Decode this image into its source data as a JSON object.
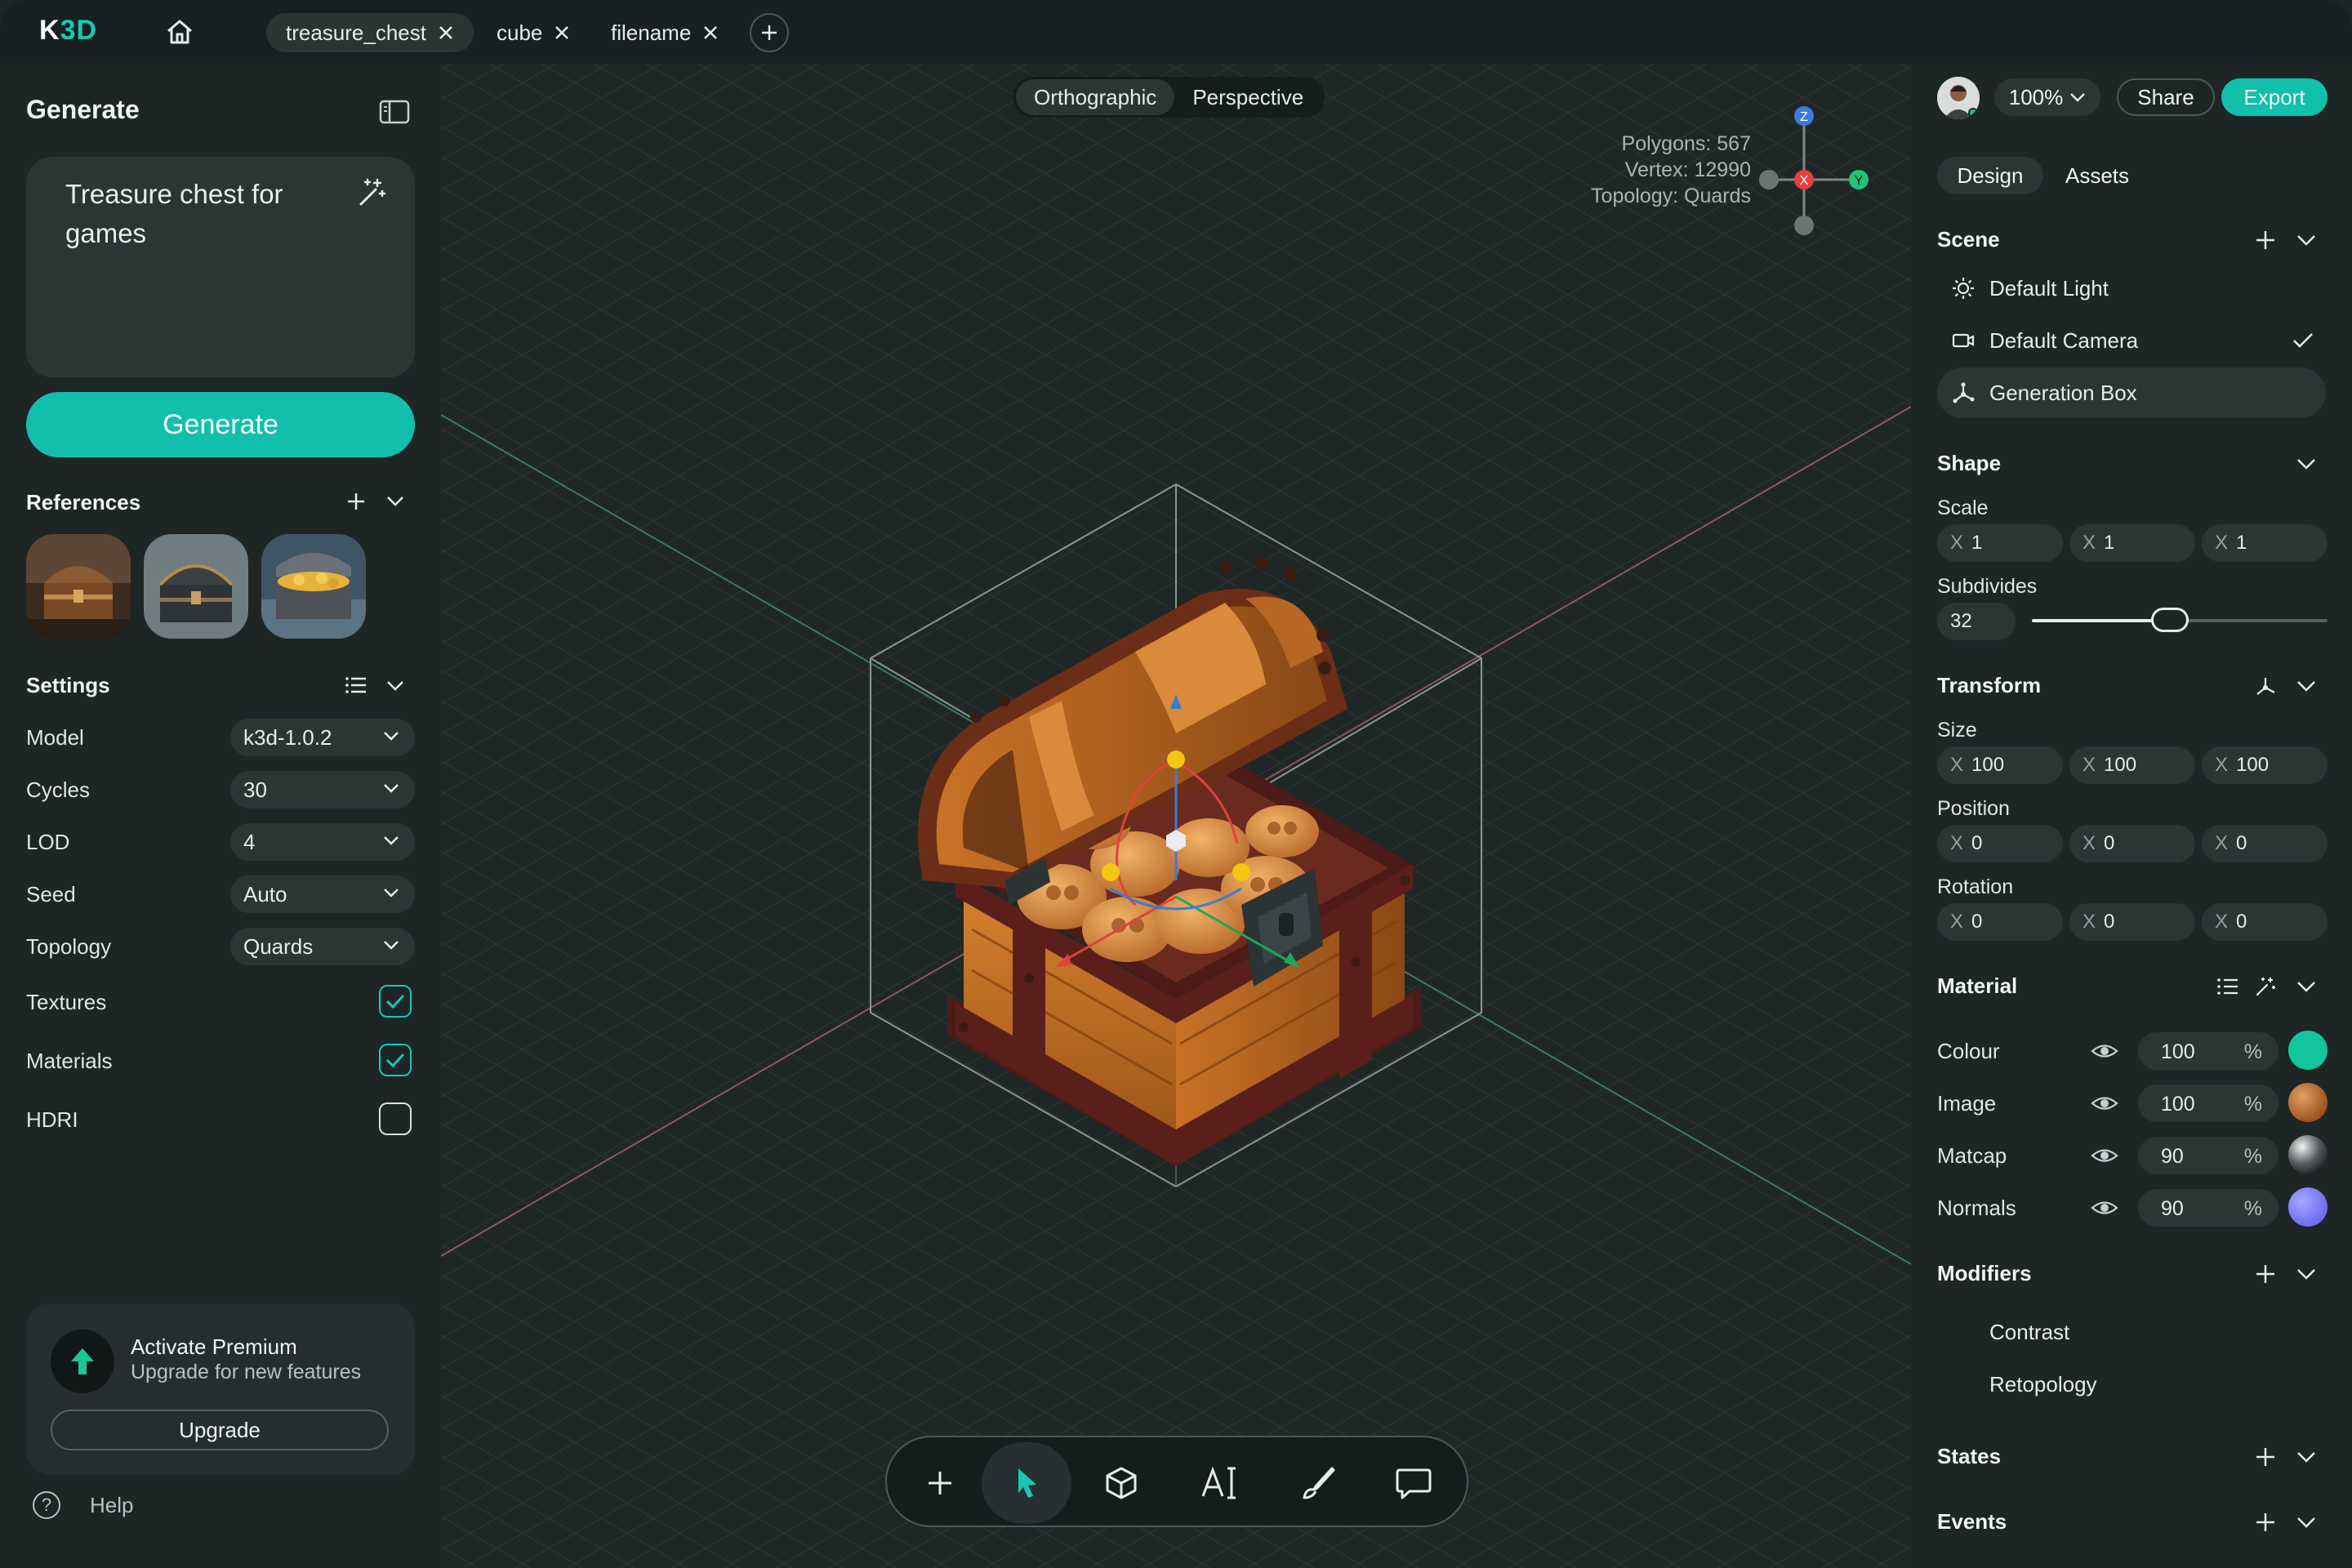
{
  "app": {
    "logo_prefix": "K",
    "logo_accent": "3D",
    "brand_color": "#12bfad"
  },
  "tabs": [
    {
      "label": "treasure_chest",
      "active": true
    },
    {
      "label": "cube",
      "active": false
    },
    {
      "label": "filename",
      "active": false
    }
  ],
  "left": {
    "title": "Generate",
    "prompt": "Treasure chest for games",
    "generate_label": "Generate",
    "references_label": "References",
    "settings_label": "Settings",
    "settings": [
      {
        "label": "Model",
        "value": "k3d-1.0.2"
      },
      {
        "label": "Cycles",
        "value": "30"
      },
      {
        "label": "LOD",
        "value": "4"
      },
      {
        "label": "Seed",
        "value": "Auto"
      },
      {
        "label": "Topology",
        "value": "Quards"
      }
    ],
    "toggles": [
      {
        "label": "Textures",
        "checked": true
      },
      {
        "label": "Materials",
        "checked": true
      },
      {
        "label": "HDRI",
        "checked": false
      }
    ],
    "premium": {
      "title": "Activate Premium",
      "subtitle": "Upgrade for new features",
      "button": "Upgrade"
    },
    "help": "Help"
  },
  "viewport": {
    "views": [
      "Orthographic",
      "Perspective"
    ],
    "active_view": "Perspective",
    "stats": [
      "Polygons: 567",
      "Vertex: 12990",
      "Topology: Quards"
    ],
    "axes": {
      "z": "Z",
      "x": "X",
      "y": "Y"
    }
  },
  "right": {
    "zoom": "100%",
    "share": "Share",
    "export": "Export",
    "tabs": [
      "Design",
      "Assets"
    ],
    "scene_label": "Scene",
    "scene_items": [
      {
        "label": "Default Light",
        "icon": "sun-icon"
      },
      {
        "label": "Default Camera",
        "icon": "camera-icon"
      },
      {
        "label": "Generation Box",
        "icon": "axes-icon"
      }
    ],
    "shape_label": "Shape",
    "scale_label": "Scale",
    "scale": [
      "1",
      "1",
      "1"
    ],
    "subdivides_label": "Subdivides",
    "subdivides": "32",
    "transform_label": "Transform",
    "size_label": "Size",
    "size": [
      "100",
      "100",
      "100"
    ],
    "position_label": "Position",
    "position": [
      "0",
      "0",
      "0"
    ],
    "rotation_label": "Rotation",
    "rotation": [
      "0",
      "0",
      "0"
    ],
    "axis_letter": "X",
    "material_label": "Material",
    "materials": [
      {
        "label": "Colour",
        "value": "100",
        "unit": "%",
        "swatch": "#12c59d"
      },
      {
        "label": "Image",
        "value": "100",
        "unit": "%",
        "swatch": "#b66a2b"
      },
      {
        "label": "Matcap",
        "value": "90",
        "unit": "%",
        "swatch": "#5a5e60"
      },
      {
        "label": "Normals",
        "value": "90",
        "unit": "%",
        "swatch": "#7a7af5"
      }
    ],
    "modifiers_label": "Modifiers",
    "modifiers": [
      "Contrast",
      "Retopology"
    ],
    "states_label": "States",
    "events_label": "Events"
  }
}
